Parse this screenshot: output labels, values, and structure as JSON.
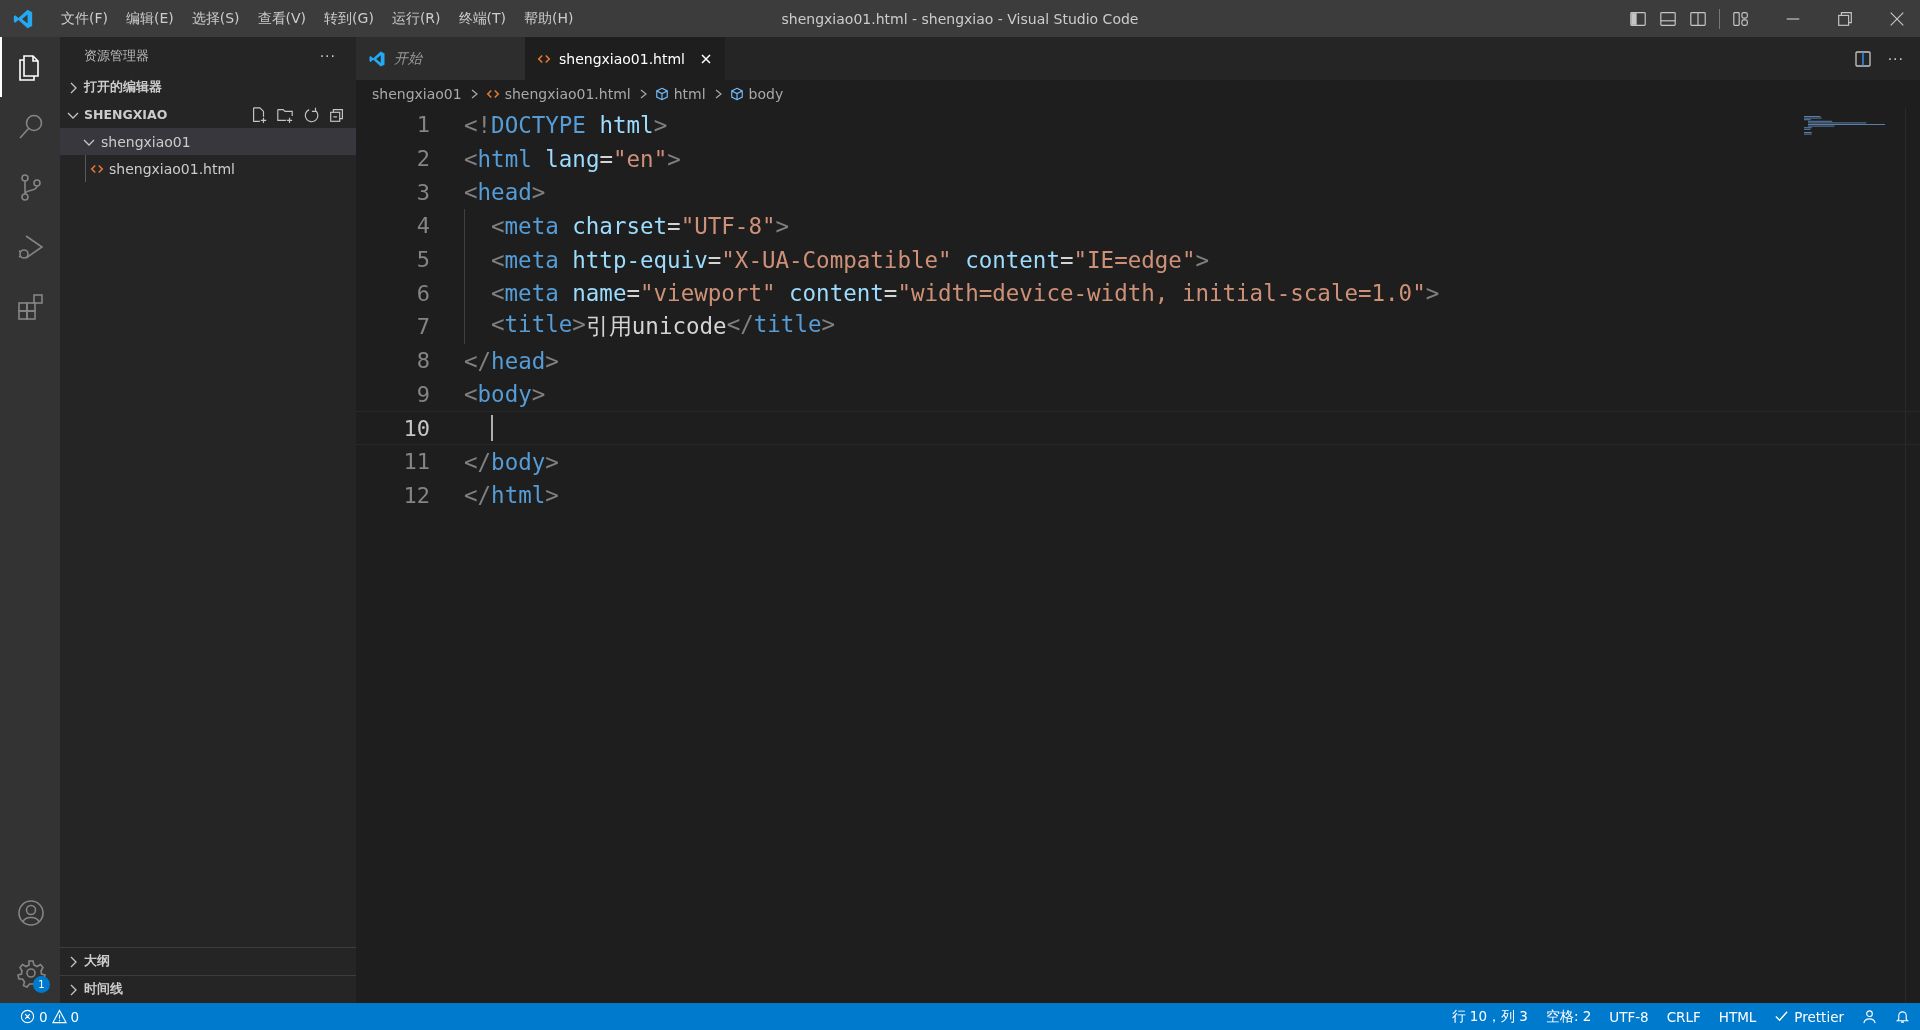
{
  "window": {
    "title": "shengxiao01.html - shengxiao - Visual Studio Code"
  },
  "menu": [
    "文件(F)",
    "编辑(E)",
    "选择(S)",
    "查看(V)",
    "转到(G)",
    "运行(R)",
    "终端(T)",
    "帮助(H)"
  ],
  "activity_bar": [
    {
      "kind": "explorer",
      "selected": true
    },
    {
      "kind": "search",
      "selected": false
    },
    {
      "kind": "scm",
      "selected": false
    },
    {
      "kind": "debug",
      "selected": false
    },
    {
      "kind": "extensions",
      "selected": false
    }
  ],
  "activity_bottom": [
    {
      "kind": "account"
    },
    {
      "kind": "settings",
      "badge": "1"
    }
  ],
  "sidebar": {
    "title": "资源管理器",
    "more": "···",
    "sections": [
      {
        "label": "打开的编辑器",
        "expanded": false
      },
      {
        "label": "SHENGXIAO",
        "expanded": true,
        "tree": [
          {
            "label": "shengxiao01",
            "kind": "folder",
            "expanded": true,
            "selected": true,
            "children": [
              {
                "label": "shengxiao01.html",
                "kind": "html",
                "selected": false
              }
            ]
          }
        ]
      }
    ],
    "bottom_sections": [
      {
        "label": "大纲",
        "expanded": false
      },
      {
        "label": "时间线",
        "expanded": false
      }
    ]
  },
  "tabs": [
    {
      "label": "开始",
      "kind": "welcome",
      "selected": false
    },
    {
      "label": "shengxiao01.html",
      "kind": "html",
      "selected": true
    }
  ],
  "breadcrumbs": [
    {
      "label": "shengxiao01",
      "kind": "folder"
    },
    {
      "label": "shengxiao01.html",
      "kind": "html"
    },
    {
      "label": "html",
      "kind": "element"
    },
    {
      "label": "body",
      "kind": "element"
    }
  ],
  "editor": {
    "lines": [
      {
        "number": "1",
        "current": false,
        "tokens": [
          {
            "kind": "punct",
            "text": "<!"
          },
          {
            "kind": "tag",
            "text": "DOCTYPE"
          },
          {
            "kind": "attr",
            "text": " html"
          },
          {
            "kind": "punct",
            "text": ">"
          }
        ]
      },
      {
        "number": "2",
        "current": false,
        "tokens": [
          {
            "kind": "punct",
            "text": "<"
          },
          {
            "kind": "tag",
            "text": "html"
          },
          {
            "kind": "attr",
            "text": " lang"
          },
          {
            "kind": "plain",
            "text": "="
          },
          {
            "kind": "string",
            "text": "\"en\""
          },
          {
            "kind": "punct",
            "text": ">"
          }
        ]
      },
      {
        "number": "3",
        "current": false,
        "tokens": [
          {
            "kind": "punct",
            "text": "<"
          },
          {
            "kind": "tag",
            "text": "head"
          },
          {
            "kind": "punct",
            "text": ">"
          }
        ]
      },
      {
        "number": "4",
        "current": false,
        "indent": true,
        "tokens": [
          {
            "kind": "punct",
            "text": "<"
          },
          {
            "kind": "tag",
            "text": "meta"
          },
          {
            "kind": "attr",
            "text": " charset"
          },
          {
            "kind": "plain",
            "text": "="
          },
          {
            "kind": "string",
            "text": "\"UTF-8\""
          },
          {
            "kind": "punct",
            "text": ">"
          }
        ]
      },
      {
        "number": "5",
        "current": false,
        "indent": true,
        "tokens": [
          {
            "kind": "punct",
            "text": "<"
          },
          {
            "kind": "tag",
            "text": "meta"
          },
          {
            "kind": "attr",
            "text": " http-equiv"
          },
          {
            "kind": "plain",
            "text": "="
          },
          {
            "kind": "string",
            "text": "\"X-UA-Compatible\""
          },
          {
            "kind": "attr",
            "text": " content"
          },
          {
            "kind": "plain",
            "text": "="
          },
          {
            "kind": "string",
            "text": "\"IE=edge\""
          },
          {
            "kind": "punct",
            "text": ">"
          }
        ]
      },
      {
        "number": "6",
        "current": false,
        "indent": true,
        "tokens": [
          {
            "kind": "punct",
            "text": "<"
          },
          {
            "kind": "tag",
            "text": "meta"
          },
          {
            "kind": "attr",
            "text": " name"
          },
          {
            "kind": "plain",
            "text": "="
          },
          {
            "kind": "string",
            "text": "\"viewport\""
          },
          {
            "kind": "attr",
            "text": " content"
          },
          {
            "kind": "plain",
            "text": "="
          },
          {
            "kind": "string",
            "text": "\"width=device-width, initial-scale=1.0\""
          },
          {
            "kind": "punct",
            "text": ">"
          }
        ]
      },
      {
        "number": "7",
        "current": false,
        "indent": true,
        "tokens": [
          {
            "kind": "punct",
            "text": "<"
          },
          {
            "kind": "tag",
            "text": "title"
          },
          {
            "kind": "punct",
            "text": ">"
          },
          {
            "kind": "plain",
            "text": "引用unicode"
          },
          {
            "kind": "punct",
            "text": "</"
          },
          {
            "kind": "tag",
            "text": "title"
          },
          {
            "kind": "punct",
            "text": ">"
          }
        ]
      },
      {
        "number": "8",
        "current": false,
        "tokens": [
          {
            "kind": "punct",
            "text": "</"
          },
          {
            "kind": "tag",
            "text": "head"
          },
          {
            "kind": "punct",
            "text": ">"
          }
        ]
      },
      {
        "number": "9",
        "current": false,
        "tokens": [
          {
            "kind": "punct",
            "text": "<"
          },
          {
            "kind": "tag",
            "text": "body"
          },
          {
            "kind": "punct",
            "text": ">"
          }
        ]
      },
      {
        "number": "10",
        "current": true,
        "cursor": true
      },
      {
        "number": "11",
        "current": false,
        "tokens": [
          {
            "kind": "punct",
            "text": "</"
          },
          {
            "kind": "tag",
            "text": "body"
          },
          {
            "kind": "punct",
            "text": ">"
          }
        ]
      },
      {
        "number": "12",
        "current": false,
        "tokens": [
          {
            "kind": "punct",
            "text": "</"
          },
          {
            "kind": "tag",
            "text": "html"
          },
          {
            "kind": "punct",
            "text": ">"
          }
        ]
      }
    ]
  },
  "status_bar": {
    "errors": "0",
    "warnings": "0",
    "items": [
      {
        "kind": "text",
        "label": "行 10，列 3"
      },
      {
        "kind": "text",
        "label": "空格: 2"
      },
      {
        "kind": "text",
        "label": "UTF-8"
      },
      {
        "kind": "text",
        "label": "CRLF"
      },
      {
        "kind": "text",
        "label": "HTML"
      },
      {
        "kind": "check",
        "label": "Prettier"
      },
      {
        "kind": "feedback"
      },
      {
        "kind": "bell"
      }
    ]
  }
}
